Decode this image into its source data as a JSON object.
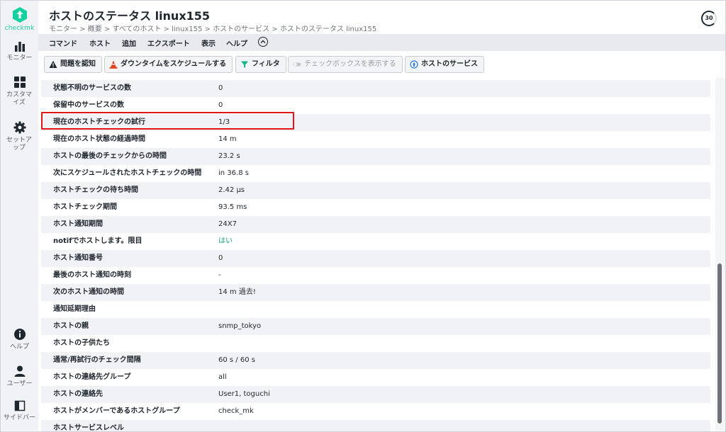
{
  "app": {
    "logo_text": "checkmk",
    "brand_color": "#15d1a0",
    "highlight_color": "#e0161b"
  },
  "sidebar": {
    "items": [
      {
        "label": "モニター",
        "icon": "bar-chart-icon"
      },
      {
        "label": "カスタマイズ",
        "icon": "grid-icon"
      },
      {
        "label": "セットアップ",
        "icon": "gear-icon"
      },
      {
        "label": "ヘルプ",
        "icon": "info-icon"
      },
      {
        "label": "ユーザー",
        "icon": "user-icon"
      },
      {
        "label": "サイドバー",
        "icon": "sidebar-icon"
      }
    ]
  },
  "header": {
    "title": "ホストのステータス linux155",
    "breadcrumb": "モニター > 概要 > すべてのホスト > linux155 > ホストのサービス > ホストのステータス linux155",
    "refresh_seconds": "30"
  },
  "menubar": {
    "items": [
      "コマンド",
      "ホスト",
      "追加",
      "エクスポート",
      "表示",
      "ヘルプ"
    ]
  },
  "toolbar": {
    "ack_label": "問題を認知",
    "downtime_label": "ダウンタイムをスケジュールする",
    "filter_label": "フィルタ",
    "checkbox_label": "チェックボックスを表示する",
    "services_label": "ホストのサービス"
  },
  "table": {
    "rows": [
      {
        "key": "状態不明のサービスの数",
        "value": "0"
      },
      {
        "key": "保留中のサービスの数",
        "value": "0"
      },
      {
        "key": "現在のホストチェックの試行",
        "value": "1/3"
      },
      {
        "key": "現在のホスト状態の経過時間",
        "value": "14 m"
      },
      {
        "key": "ホストの最後のチェックからの時間",
        "value": "23.2 s"
      },
      {
        "key": "次にスケジュールされたホストチェックの時間",
        "value": "in 36.8 s"
      },
      {
        "key": "ホストチェックの待ち時間",
        "value": "2.42 μs"
      },
      {
        "key": "ホストチェック期間",
        "value": "93.5 ms"
      },
      {
        "key": "ホスト通知期間",
        "value": "24X7"
      },
      {
        "key": "notifでホストします。限目",
        "value": "はい"
      },
      {
        "key": "ホスト通知番号",
        "value": "0"
      },
      {
        "key": "最後のホスト通知の時刻",
        "value": "-"
      },
      {
        "key": "次のホスト通知の時間",
        "value": "14 m 過去!"
      },
      {
        "key": "通知延期理由",
        "value": ""
      },
      {
        "key": "ホストの親",
        "value": "snmp_tokyo"
      },
      {
        "key": "ホストの子供たち",
        "value": ""
      },
      {
        "key": "通常/再試行のチェック間隔",
        "value": "60 s / 60 s"
      },
      {
        "key": "ホストの連絡先グループ",
        "value": "all"
      },
      {
        "key": "ホストの連絡先",
        "value": "User1, toguchi"
      },
      {
        "key": "ホストがメンバーであるホストグループ",
        "value": "check_mk"
      },
      {
        "key": "ホストサービスレベル",
        "value": ""
      }
    ]
  }
}
